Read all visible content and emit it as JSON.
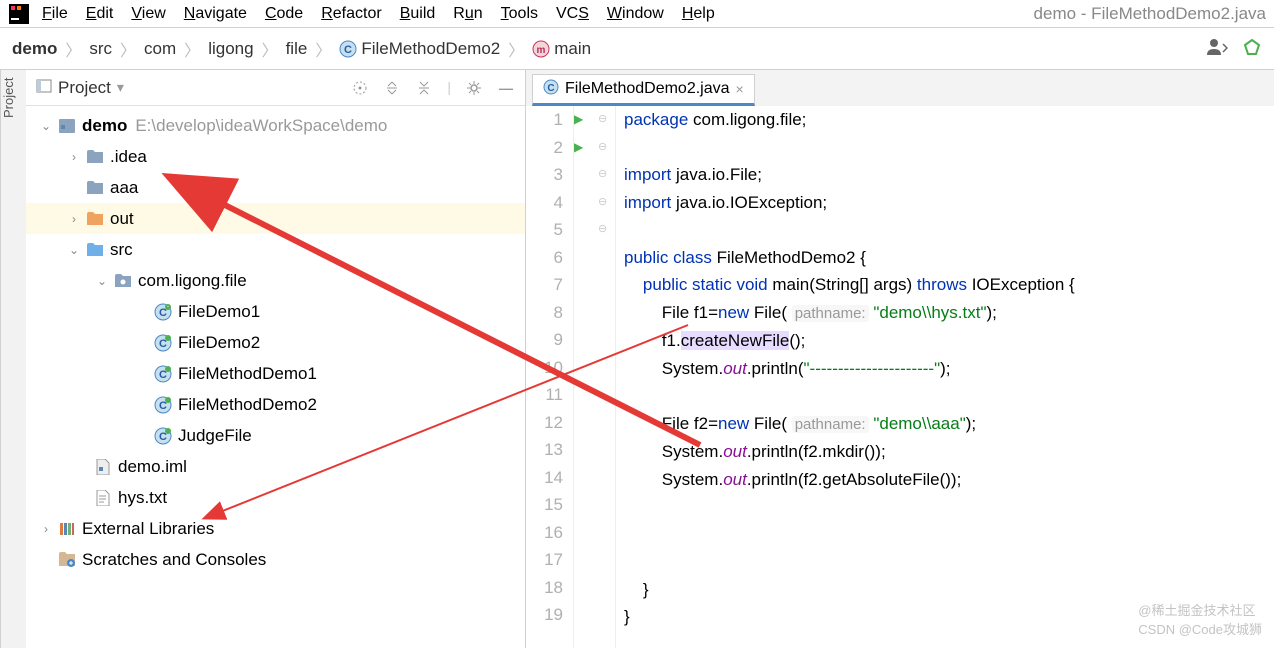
{
  "window_title": "demo - FileMethodDemo2.java",
  "menu": [
    "File",
    "Edit",
    "View",
    "Navigate",
    "Code",
    "Refactor",
    "Build",
    "Run",
    "Tools",
    "VCS",
    "Window",
    "Help"
  ],
  "breadcrumbs": [
    "demo",
    "src",
    "com",
    "ligong",
    "file",
    "FileMethodDemo2",
    "main"
  ],
  "panel": {
    "title": "Project"
  },
  "sidebar_label": "Project",
  "tree": {
    "demo": {
      "name": "demo",
      "path": "E:\\develop\\ideaWorkSpace\\demo"
    },
    "idea": ".idea",
    "aaa": "aaa",
    "out": "out",
    "src": "src",
    "pkg": "com.ligong.file",
    "files": [
      "FileDemo1",
      "FileDemo2",
      "FileMethodDemo1",
      "FileMethodDemo2",
      "JudgeFile"
    ],
    "iml": "demo.iml",
    "hys": "hys.txt",
    "ext": "External Libraries",
    "scratch": "Scratches and Consoles"
  },
  "tab_name": "FileMethodDemo2.java",
  "code_lines": [
    "package com.ligong.file;",
    "",
    "import java.io.File;",
    "import java.io.IOException;",
    "",
    "public class FileMethodDemo2 {",
    "    public static void main(String[] args) throws IOException {",
    "        File f1=new File( pathname: \"demo\\\\hys.txt\");",
    "        f1.createNewFile();",
    "        System.out.println(\"----------------------\");",
    "",
    "        File f2=new File( pathname: \"demo\\\\aaa\");",
    "        System.out.println(f2.mkdir());",
    "        System.out.println(f2.getAbsoluteFile());",
    "",
    "",
    "",
    "    }",
    "}"
  ],
  "line_numbers": [
    "1",
    "2",
    "3",
    "4",
    "5",
    "6",
    "7",
    "8",
    "9",
    "10",
    "11",
    "12",
    "13",
    "14",
    "15",
    "16",
    "17",
    "18",
    "19"
  ],
  "watermark": "CSDN @Code攻城狮",
  "watermark2": "@稀土掘金技术社区"
}
